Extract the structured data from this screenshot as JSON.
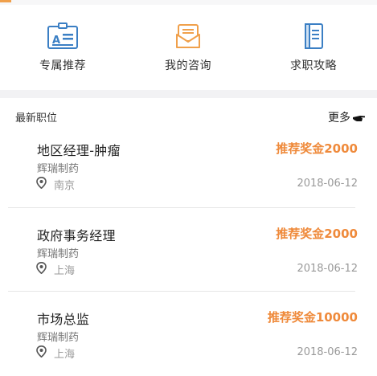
{
  "quick_links": [
    {
      "label": "专属推荐",
      "icon": "id-card-icon"
    },
    {
      "label": "我的咨询",
      "icon": "envelope-icon"
    },
    {
      "label": "求职攻略",
      "icon": "book-icon"
    }
  ],
  "section": {
    "title": "最新职位",
    "more_label": "更多",
    "more_icon": "pointing-hand-icon"
  },
  "jobs": [
    {
      "title": "地区经理-肿瘤",
      "bonus": "推荐奖金2000",
      "company": "辉瑞制药",
      "location": "南京",
      "date": "2018-06-12"
    },
    {
      "title": "政府事务经理",
      "bonus": "推荐奖金2000",
      "company": "辉瑞制药",
      "location": "上海",
      "date": "2018-06-12"
    },
    {
      "title": "市场总监",
      "bonus": "推荐奖金10000",
      "company": "辉瑞制药",
      "location": "上海",
      "date": "2018-06-12"
    }
  ],
  "colors": {
    "accent": "#ef8a3b",
    "icon_blue": "#3b7fc4",
    "icon_orange": "#f0a04b"
  }
}
